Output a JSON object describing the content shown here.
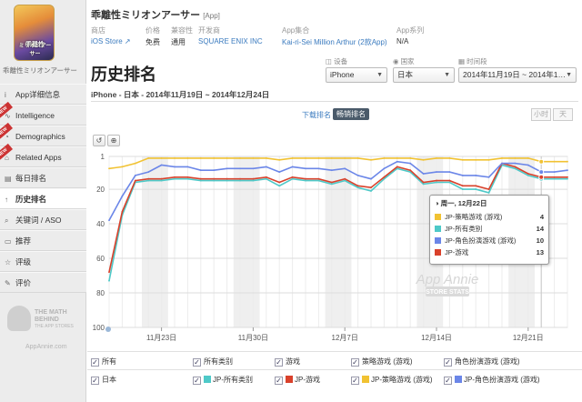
{
  "app": {
    "name": "乖離性ミリオンアーサー",
    "type_tag": "[App]",
    "sidebar_name": "乖離性ミリオンアーサー",
    "icon_text": "乖離性",
    "icon_text2": "ミリオンアーサー"
  },
  "meta": [
    {
      "key": "商店",
      "value": "iOS Store ↗",
      "link": true
    },
    {
      "key": "价格",
      "value": "免费",
      "link": false
    },
    {
      "key": "兼容性",
      "value": "通用",
      "link": false
    },
    {
      "key": "开发商",
      "value": "SQUARE ENIX INC",
      "link": true
    },
    {
      "key": "App集合",
      "value": "Kai-ri-Sei Million Arthur (2款App)",
      "link": true
    },
    {
      "key": "App系列",
      "value": "N/A",
      "link": false
    }
  ],
  "sidebar": {
    "items": [
      {
        "icon": "i",
        "label": "App详细信息",
        "active": false,
        "new": false
      },
      {
        "icon": "∿",
        "label": "Intelligence",
        "active": false,
        "new": true
      },
      {
        "icon": "◔",
        "label": "Demographics",
        "active": false,
        "new": true
      },
      {
        "icon": "⌂",
        "label": "Related Apps",
        "active": false,
        "new": true
      },
      {
        "icon": "▤",
        "label": "每日排名",
        "active": false,
        "new": false
      },
      {
        "icon": "↑",
        "label": "历史排名",
        "active": true,
        "new": false
      },
      {
        "icon": "⌕",
        "label": "关键词 / ASO",
        "active": false,
        "new": false
      },
      {
        "icon": "▭",
        "label": "推荐",
        "active": false,
        "new": false
      },
      {
        "icon": "☆",
        "label": "评级",
        "active": false,
        "new": false
      },
      {
        "icon": "✎",
        "label": "评价",
        "active": false,
        "new": false
      }
    ],
    "promo": {
      "line1": "THE MATH",
      "line2": "BEHIND",
      "line3": "THE APP STORES",
      "line4": "AppAnnie.com"
    }
  },
  "page": {
    "heading": "历史排名",
    "subtitle": "iPhone - 日本 - 2014年11月19日 ~ 2014年12月24日"
  },
  "selectors": {
    "device": {
      "label": "设备",
      "value": "iPhone"
    },
    "country": {
      "label": "国家",
      "value": "日本"
    },
    "range": {
      "label": "时间段",
      "value": "2014年11月19日 ~ 2014年1…"
    }
  },
  "chart_tabs": {
    "downloads": "下载排名",
    "grossing": "畅销排名",
    "hour": "小时",
    "day": "天"
  },
  "tools": {
    "reset": "↺",
    "zoom": "⊕"
  },
  "watermark": {
    "line1": "App Annie",
    "line2": "STORE STATS"
  },
  "tooltip": {
    "date": "周一, 12月22日",
    "rows": [
      {
        "label": "JP-策略游戏 (游戏)",
        "value": "4",
        "color": "#f1c232"
      },
      {
        "label": "JP-所有类别",
        "value": "14",
        "color": "#4ec9c8"
      },
      {
        "label": "JP-角色扮演游戏 (游戏)",
        "value": "10",
        "color": "#6b86e8"
      },
      {
        "label": "JP-游戏",
        "value": "13",
        "color": "#d9412b"
      }
    ]
  },
  "legend": {
    "row1": [
      "所有",
      "所有类别",
      "游戏",
      "策略游戏 (游戏)",
      "角色扮演游戏 (游戏)"
    ],
    "row2_label": "日本",
    "row2": [
      {
        "label": "JP-所有类别",
        "color": "#4ec9c8"
      },
      {
        "label": "JP-游戏",
        "color": "#d9412b"
      },
      {
        "label": "JP-策略游戏 (游戏)",
        "color": "#f1c232"
      },
      {
        "label": "JP-角色扮演游戏 (游戏)",
        "color": "#6b86e8"
      }
    ]
  },
  "chart_data": {
    "type": "line",
    "title": "",
    "xlabel": "",
    "ylabel": "",
    "x": [
      "11/19",
      "11/20",
      "11/21",
      "11/22",
      "11/23",
      "11/24",
      "11/25",
      "11/26",
      "11/27",
      "11/28",
      "11/29",
      "11/30",
      "12/1",
      "12/2",
      "12/3",
      "12/4",
      "12/5",
      "12/6",
      "12/7",
      "12/8",
      "12/9",
      "12/10",
      "12/11",
      "12/12",
      "12/13",
      "12/14",
      "12/15",
      "12/16",
      "12/17",
      "12/18",
      "12/19",
      "12/20",
      "12/21",
      "12/22",
      "12/23",
      "12/24"
    ],
    "x_ticks": [
      "11月23日",
      "11月30日",
      "12月7日",
      "12月14日",
      "12月21日"
    ],
    "y_ticks": [
      1,
      20,
      40,
      60,
      80,
      100
    ],
    "ylim": [
      1,
      100
    ],
    "y_inverted": true,
    "grid": true,
    "series": [
      {
        "name": "JP-所有类别",
        "color": "#4ec9c8",
        "values": [
          73,
          35,
          16,
          15,
          15,
          14,
          14,
          15,
          15,
          15,
          15,
          15,
          14,
          18,
          14,
          15,
          15,
          17,
          15,
          19,
          21,
          14,
          8,
          10,
          17,
          16,
          16,
          20,
          20,
          22,
          6,
          8,
          12,
          14,
          14,
          14
        ]
      },
      {
        "name": "JP-游戏",
        "color": "#d9412b",
        "values": [
          68,
          33,
          15,
          14,
          14,
          13,
          13,
          14,
          14,
          14,
          14,
          14,
          13,
          16,
          13,
          14,
          14,
          16,
          14,
          18,
          19,
          13,
          7,
          9,
          16,
          15,
          15,
          18,
          18,
          20,
          5,
          7,
          11,
          13,
          13,
          13
        ]
      },
      {
        "name": "JP-策略游戏 (游戏)",
        "color": "#f1c232",
        "values": [
          8,
          7,
          5,
          2,
          2,
          2,
          2,
          2,
          2,
          2,
          2,
          2,
          2,
          3,
          2,
          2,
          2,
          2,
          2,
          2,
          3,
          2,
          2,
          2,
          3,
          2,
          2,
          3,
          3,
          3,
          2,
          2,
          2,
          4,
          4,
          4
        ]
      },
      {
        "name": "JP-角色扮演游戏 (游戏)",
        "color": "#6b86e8",
        "values": [
          38,
          24,
          12,
          10,
          6,
          7,
          7,
          9,
          9,
          8,
          8,
          8,
          7,
          10,
          7,
          8,
          8,
          9,
          8,
          12,
          14,
          8,
          4,
          5,
          11,
          10,
          10,
          12,
          12,
          13,
          5,
          5,
          6,
          10,
          10,
          9
        ]
      }
    ]
  }
}
